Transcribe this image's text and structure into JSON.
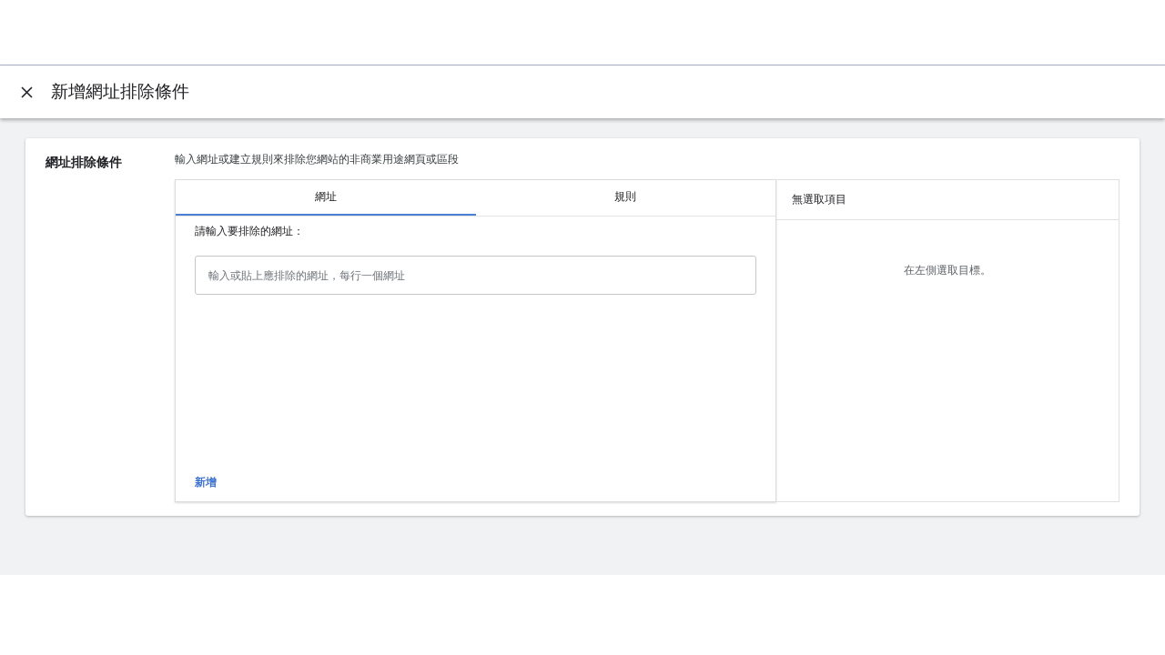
{
  "header": {
    "title": "新增網址排除條件"
  },
  "section": {
    "label": "網址排除條件",
    "description": "輸入網址或建立規則來排除您網站的非商業用途網頁或區段"
  },
  "tabs": [
    {
      "label": "網址",
      "selected": true
    },
    {
      "label": "規則",
      "selected": false
    }
  ],
  "url_input": {
    "prompt": "請輸入要排除的網址：",
    "placeholder": "輸入或貼上應排除的網址，每行一個網址"
  },
  "add_link": "新增",
  "selection": {
    "title": "無選取項目",
    "empty_message": "在左側選取目標。"
  }
}
